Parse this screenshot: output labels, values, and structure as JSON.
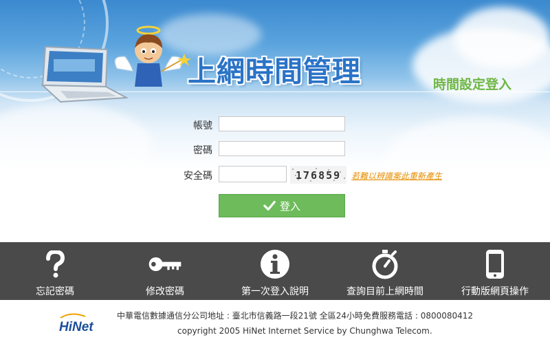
{
  "banner": {
    "title": "上網時間管理",
    "subtitle": "時間設定登入"
  },
  "form": {
    "account_label": "帳號",
    "account_value": "",
    "password_label": "密碼",
    "password_value": "",
    "captcha_label": "安全碼",
    "captcha_value": "",
    "captcha_image_text": "176859",
    "regenerate_link": "若難以辨識案此重新產生",
    "login_button": "登入"
  },
  "nav": {
    "items": [
      {
        "label": "忘記密碼",
        "icon": "question-icon"
      },
      {
        "label": "修改密碼",
        "icon": "key-icon"
      },
      {
        "label": "第一次登入說明",
        "icon": "info-icon"
      },
      {
        "label": "查詢目前上網時間",
        "icon": "stopwatch-icon"
      },
      {
        "label": "行動版網頁操作",
        "icon": "mobile-phone-icon"
      }
    ]
  },
  "footer": {
    "logo_text": "HiNet",
    "address_line": "中華電信數據通信分公司地址 : 臺北市信義路一段21號 全區24小時免費服務電話 : 0800080412",
    "copyright": "copyright 2005 HiNet Internet Service by Chunghwa Telecom."
  },
  "colors": {
    "title_blue": "#2a73c7",
    "subtitle_green": "#6fb644",
    "button_green": "#6dbb5a",
    "navbar_gray": "#4a4a4a",
    "link_orange": "#e58e00"
  }
}
